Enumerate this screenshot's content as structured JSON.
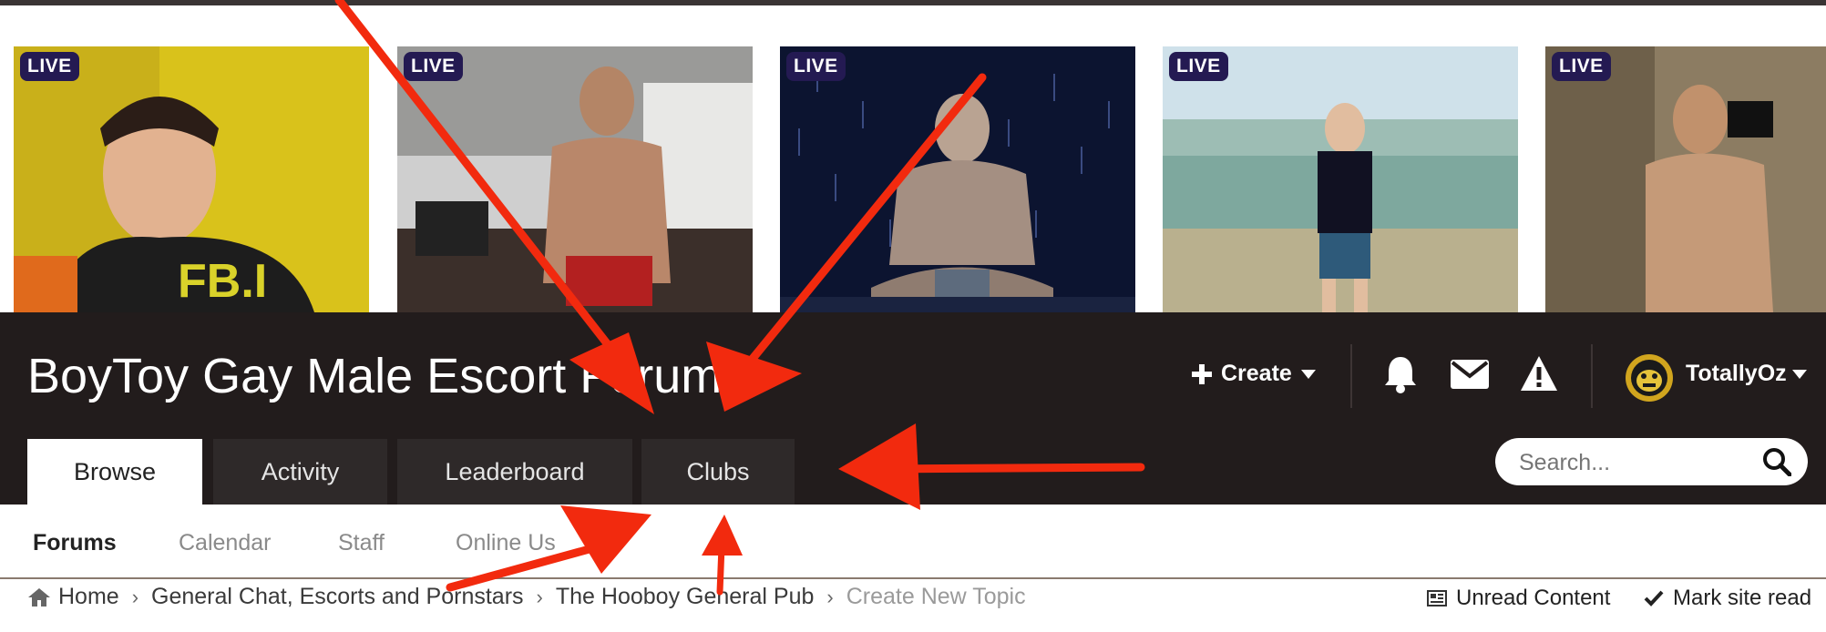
{
  "banner": {
    "cams": [
      {
        "badge": "LIVE",
        "shirt_text": "FB.I"
      },
      {
        "badge": "LIVE"
      },
      {
        "badge": "LIVE"
      },
      {
        "badge": "LIVE"
      },
      {
        "badge": "LIVE"
      }
    ]
  },
  "header": {
    "title": "BoyToy Gay Male Escort Forum",
    "create_label": "Create",
    "username": "TotallyOz"
  },
  "nav": {
    "tabs": [
      {
        "label": "Browse",
        "active": true
      },
      {
        "label": "Activity"
      },
      {
        "label": "Leaderboard"
      },
      {
        "label": "Clubs"
      }
    ],
    "search_placeholder": "Search..."
  },
  "subnav": {
    "items": [
      {
        "label": "Forums",
        "active": true
      },
      {
        "label": "Calendar"
      },
      {
        "label": "Staff"
      },
      {
        "label": "Online Us"
      }
    ]
  },
  "breadcrumb": {
    "items": [
      "Home",
      "General Chat, Escorts and Pornstars",
      "The Hooboy General Pub"
    ],
    "current": "Create New Topic"
  },
  "actions": {
    "unread": "Unread Content",
    "mark_read": "Mark site read"
  },
  "colors": {
    "header_bg": "#221c1c",
    "tab_bg": "#2e2929",
    "live_badge": "#241a52",
    "arrow": "#f22a0e"
  }
}
